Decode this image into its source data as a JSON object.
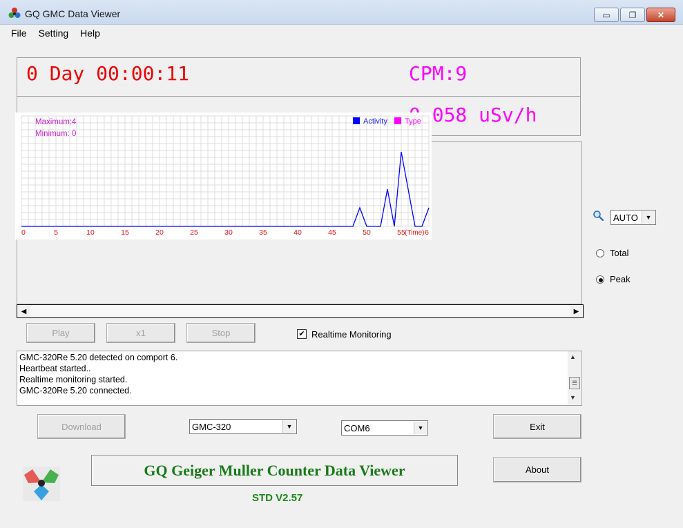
{
  "window": {
    "title": "GQ GMC Data Viewer",
    "controls": {
      "minimize": "▭",
      "maximize": "❐",
      "close": "✕"
    }
  },
  "menu": {
    "file": "File",
    "setting": "Setting",
    "help": "Help"
  },
  "display": {
    "timer": "0 Day 00:00:11",
    "cpm": "CPM:9",
    "dose": "0.058 uSv/h",
    "timer_color": "#ee0000",
    "reading_color": "#ff00ff"
  },
  "chart": {
    "max_label": "Maximum:4",
    "min_label": "Minimum: 0",
    "legend": [
      {
        "name": "Activity",
        "color": "#0000ff"
      },
      {
        "name": "Type",
        "color": "#ff00ff"
      }
    ],
    "x_ticks": [
      "0",
      "5",
      "10",
      "15",
      "20",
      "25",
      "30",
      "35",
      "40",
      "45",
      "50",
      "55",
      "6"
    ],
    "x_unit": "(Time)"
  },
  "chart_data": {
    "type": "line",
    "x": [
      0,
      48,
      49,
      50,
      52,
      53,
      54,
      55,
      56,
      57,
      58,
      59
    ],
    "y": [
      0,
      0,
      1,
      0,
      0,
      2,
      0,
      4,
      2,
      0,
      0,
      1
    ],
    "xlim": [
      0,
      59
    ],
    "ylim": [
      0,
      5
    ],
    "grid": true,
    "legend_position": "top-right",
    "series": [
      {
        "name": "Activity",
        "color": "#0000ff"
      }
    ]
  },
  "playback": {
    "play": "Play",
    "speed": "x1",
    "stop": "Stop"
  },
  "realtime": {
    "label": "Realtime Monitoring",
    "checked": "✔"
  },
  "log": {
    "lines": [
      "GMC-320Re 5.20 detected on comport 6.",
      "Heartbeat started..",
      "Realtime monitoring started.",
      "GMC-320Re 5.20 connected."
    ]
  },
  "controls": {
    "download": "Download",
    "model": "GMC-320",
    "port": "COM6",
    "exit": "Exit",
    "about": "About",
    "dropdown_arrow": "▼"
  },
  "banner": {
    "title": "GQ Geiger Muller Counter Data Viewer",
    "version": "STD V2.57"
  },
  "side": {
    "zoom": "AUTO",
    "total": "Total",
    "peak": "Peak"
  },
  "scroll": {
    "left": "◀",
    "right": "▶",
    "up": "▲",
    "down": "▼",
    "grip": "☰"
  }
}
